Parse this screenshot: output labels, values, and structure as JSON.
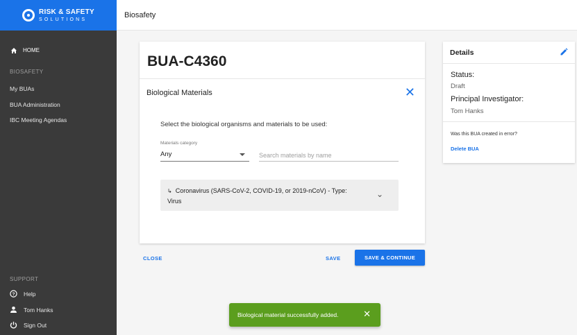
{
  "brand": {
    "line1": "RISK & SAFETY",
    "line2": "SOLUTIONS"
  },
  "topbar": {
    "title": "Biosafety"
  },
  "sidebar": {
    "home_label": "HOME",
    "section_biosafety": "BIOSAFETY",
    "items": [
      "My BUAs",
      "BUA Administration",
      "IBC Meeting Agendas"
    ],
    "section_support": "SUPPORT",
    "help_label": "Help",
    "user_label": "Tom Hanks",
    "signout_label": "Sign Out"
  },
  "main": {
    "bua_id": "BUA-C4360",
    "section_title": "Biological Materials",
    "instructions": "Select the biological organisms and materials to be used:",
    "category_label": "Materials category",
    "category_value": "Any",
    "search_placeholder": "Search materials by name",
    "material_line1": "Coronavirus (SARS-CoV-2, COVID-19, or 2019-nCoV) - Type:",
    "material_line2": "Virus"
  },
  "actions": {
    "close_label": "CLOSE",
    "save_label": "SAVE",
    "save_continue_label": "SAVE & CONTINUE"
  },
  "details": {
    "title": "Details",
    "status_label": "Status:",
    "status_value": "Draft",
    "pi_label": "Principal Investigator:",
    "pi_value": "Tom Hanks",
    "error_question": "Was this BUA created in error?",
    "delete_label": "Delete BUA"
  },
  "snackbar": {
    "message": "Biological material successfully added."
  },
  "colors": {
    "accent": "#1a73e8",
    "sidebar": "#3a3a3a",
    "success": "#5b9e1e"
  }
}
